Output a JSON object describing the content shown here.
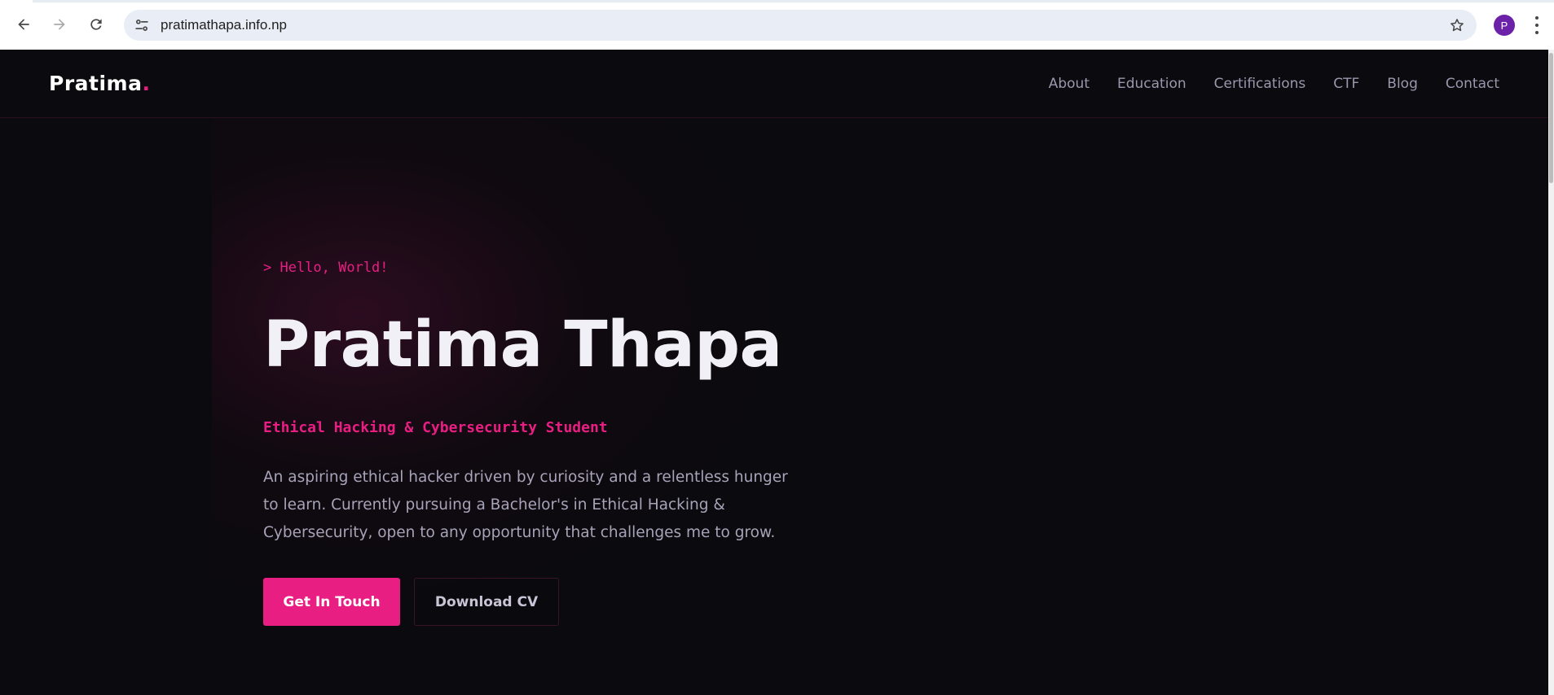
{
  "browser": {
    "url": "pratimathapa.info.np",
    "profile_initial": "P"
  },
  "icons": {
    "back": "arrow-left-icon",
    "forward": "arrow-right-icon",
    "reload": "reload-icon",
    "site_info": "tune-icon",
    "bookmark": "star-icon",
    "menu": "kebab-menu-icon"
  },
  "site": {
    "logo_text": "Pratima",
    "logo_dot": ".",
    "nav": [
      "About",
      "Education",
      "Certifications",
      "CTF",
      "Blog",
      "Contact"
    ]
  },
  "hero": {
    "greeting": "> Hello, World!",
    "name": "Pratima Thapa",
    "role": "Ethical Hacking & Cybersecurity Student",
    "bio": "An aspiring ethical hacker driven by curiosity and a relentless hunger to learn. Currently pursuing a Bachelor's in Ethical Hacking & Cybersecurity, open to any opportunity that challenges me to grow.",
    "primary_button": "Get In Touch",
    "secondary_button": "Download CV"
  },
  "colors": {
    "accent": "#e91e82",
    "background": "#0b0a0e",
    "heading": "#f2f0f7",
    "muted": "#a7a3b8"
  }
}
